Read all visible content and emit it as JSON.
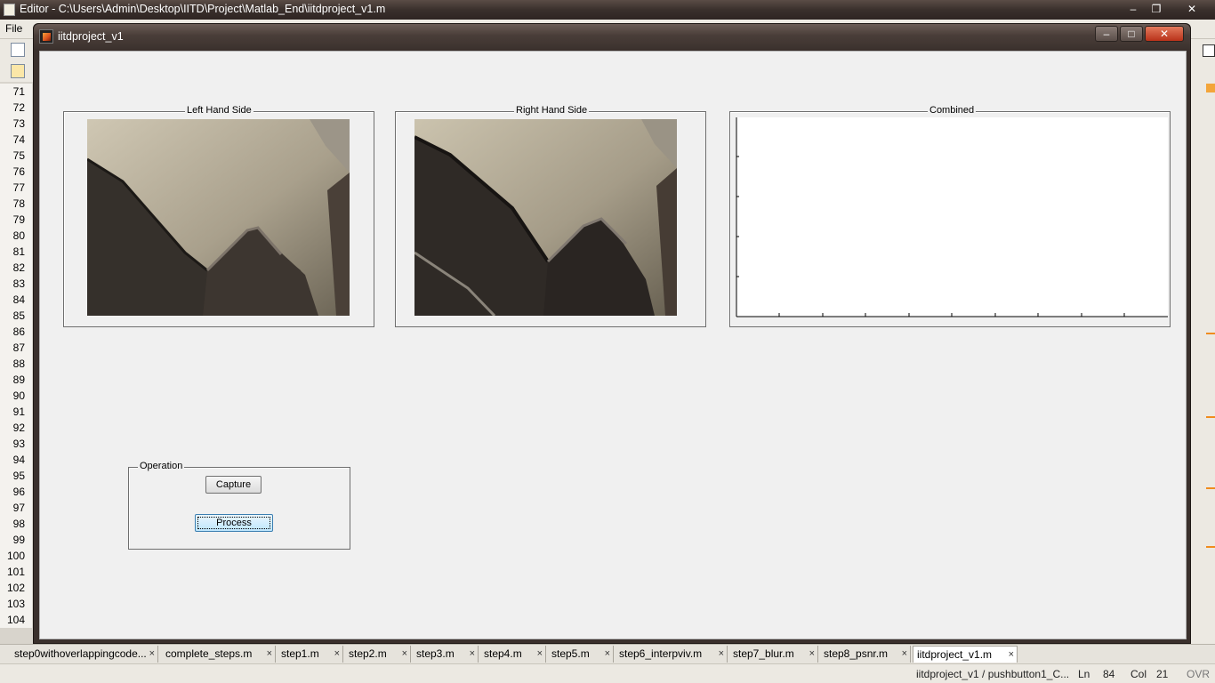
{
  "editor": {
    "title": "Editor - C:\\Users\\Admin\\Desktop\\IITD\\Project\\Matlab_End\\iitdproject_v1.m",
    "menu_file": "File",
    "line_numbers": [
      "71",
      "72",
      "73",
      "74",
      "75",
      "76",
      "77",
      "78",
      "79",
      "80",
      "81",
      "82",
      "83",
      "84",
      "85",
      "86",
      "87",
      "88",
      "89",
      "90",
      "91",
      "92",
      "93",
      "94",
      "95",
      "96",
      "97",
      "98",
      "99",
      "100",
      "101",
      "102",
      "103",
      "104"
    ],
    "tabs": [
      {
        "label": "step0withoverlappingcode..."
      },
      {
        "label": "complete_steps.m"
      },
      {
        "label": "step1.m"
      },
      {
        "label": "step2.m"
      },
      {
        "label": "step3.m"
      },
      {
        "label": "step4.m"
      },
      {
        "label": "step5.m"
      },
      {
        "label": "step6_interpviv.m"
      },
      {
        "label": "step7_blur.m"
      },
      {
        "label": "step8_psnr.m"
      },
      {
        "label": "iitdproject_v1.m"
      }
    ],
    "status": {
      "context": "iitdproject_v1 / pushbutton1_C...",
      "ln_label": "Ln",
      "ln_value": "84",
      "col_label": "Col",
      "col_value": "21",
      "mode": "OVR"
    }
  },
  "figure": {
    "title": "iitdproject_v1",
    "panels": {
      "left": {
        "title": "Left Hand Side"
      },
      "right": {
        "title": "Right Hand Side"
      },
      "combined": {
        "title": "Combined"
      }
    },
    "operation": {
      "title": "Operation",
      "capture_label": "Capture",
      "process_label": "Process"
    }
  }
}
